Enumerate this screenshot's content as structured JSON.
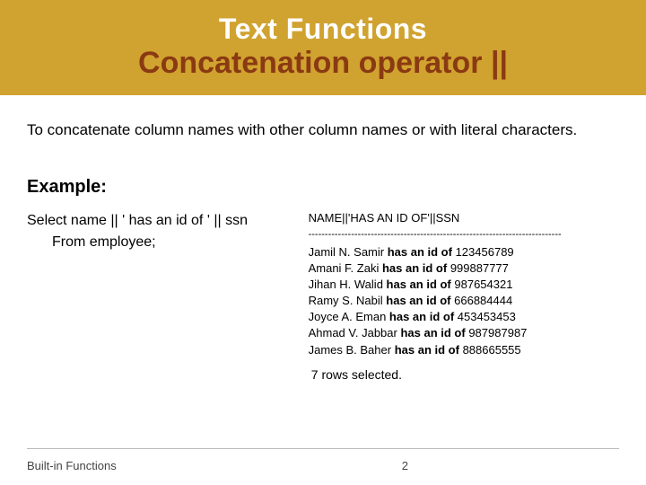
{
  "title": {
    "line1": "Text Functions",
    "line2": "Concatenation operator ||"
  },
  "description": "To concatenate column names with other column names or with literal characters.",
  "example_label": "Example:",
  "query": {
    "line1": "Select name || ' has an id of ' || ssn",
    "line2": "From employee;"
  },
  "output": {
    "header": "NAME||'HAS AN ID OF'||SSN",
    "rule": "-----------------------------------------------------------------------------",
    "rows": [
      {
        "name": "Jamil N. Samir",
        "mid": " has an id of ",
        "id": "123456789"
      },
      {
        "name": "Amani F. Zaki",
        "mid": " has an id of ",
        "id": "999887777"
      },
      {
        "name": "Jihan H. Walid",
        "mid": " has an id of ",
        "id": "987654321"
      },
      {
        "name": "Ramy S. Nabil",
        "mid": " has an id of ",
        "id": "666884444"
      },
      {
        "name": "Joyce A. Eman",
        "mid": " has an id of ",
        "id": "453453453"
      },
      {
        "name": "Ahmad V. Jabbar",
        "mid": " has an id of ",
        "id": "987987987"
      },
      {
        "name": "James B. Baher",
        "mid": " has an id of ",
        "id": "888665555"
      }
    ],
    "summary": "7 rows selected."
  },
  "footer": {
    "left": "Built-in Functions",
    "page": "2"
  }
}
